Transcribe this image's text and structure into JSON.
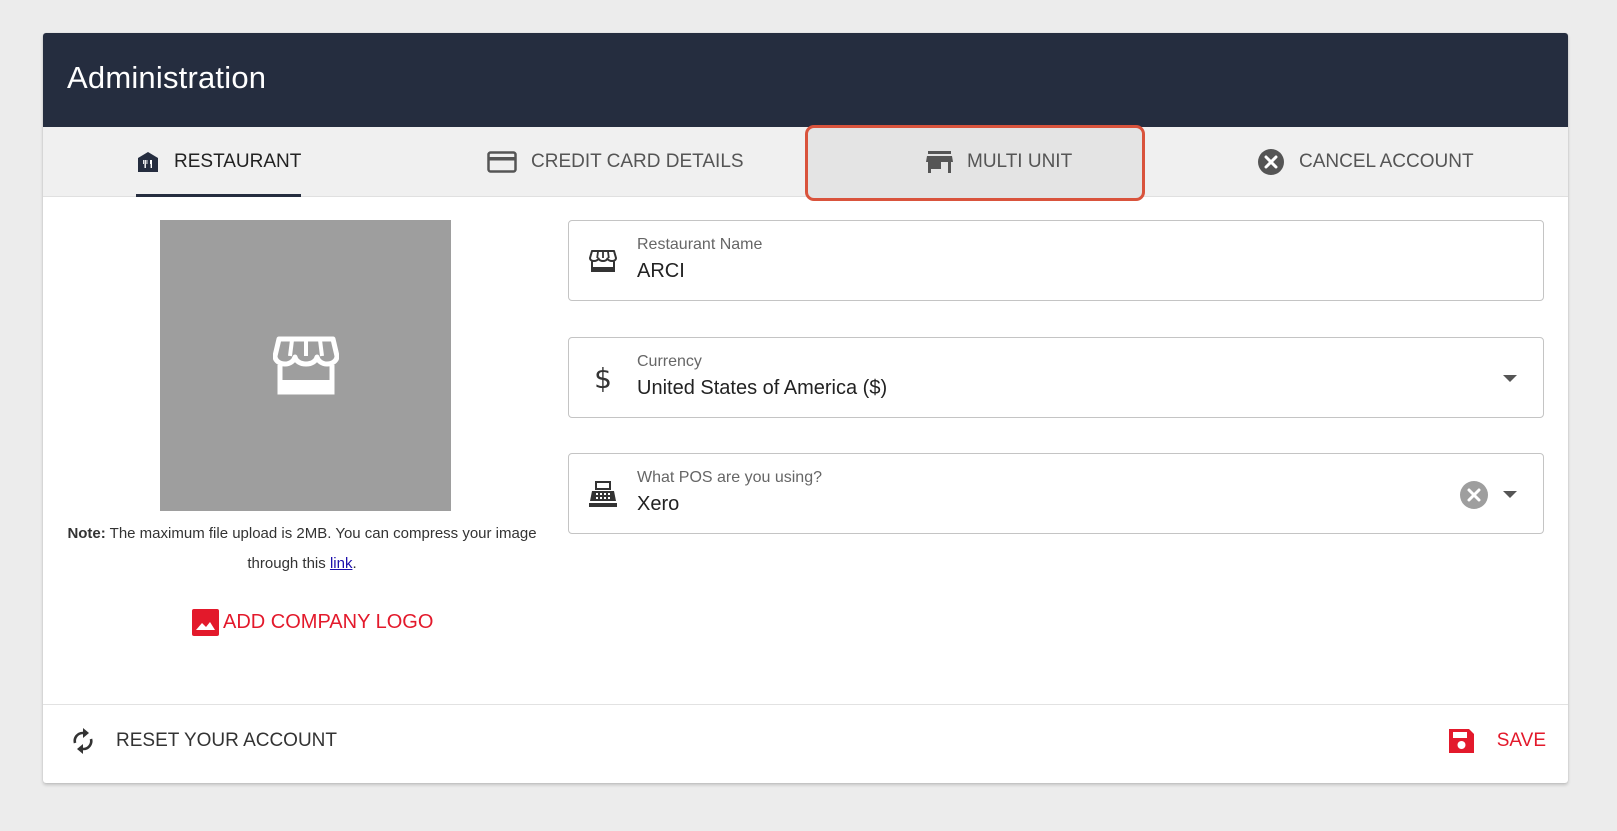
{
  "header": {
    "title": "Administration"
  },
  "tabs": [
    {
      "label": "RESTAURANT",
      "icon": "restaurant-icon",
      "active": true
    },
    {
      "label": "CREDIT CARD DETAILS",
      "icon": "credit-card-icon",
      "active": false
    },
    {
      "label": "MULTI UNIT",
      "icon": "store-icon",
      "active": false
    },
    {
      "label": "CANCEL ACCOUNT",
      "icon": "cancel-circle-icon",
      "active": false
    }
  ],
  "logo": {
    "placeholder_icon": "storefront-icon",
    "note_bold": "Note:",
    "note_text": "The maximum file upload is 2MB. You can compress your image through this",
    "note_link": "link",
    "note_end": ".",
    "add_label": "ADD COMPANY LOGO"
  },
  "fields": {
    "restaurant_name": {
      "label": "Restaurant Name",
      "value": "ARCI",
      "icon": "storefront-icon"
    },
    "currency": {
      "label": "Currency",
      "value": "United States of America ($)",
      "icon": "dollar-icon"
    },
    "pos": {
      "label": "What POS are you using?",
      "value": "Xero",
      "icon": "cash-register-icon"
    }
  },
  "footer": {
    "reset_label": "RESET YOUR ACCOUNT",
    "save_label": "SAVE"
  },
  "colors": {
    "header_bg": "#252d3f",
    "accent_red": "#e3192b",
    "highlight_border": "#d9533c"
  }
}
